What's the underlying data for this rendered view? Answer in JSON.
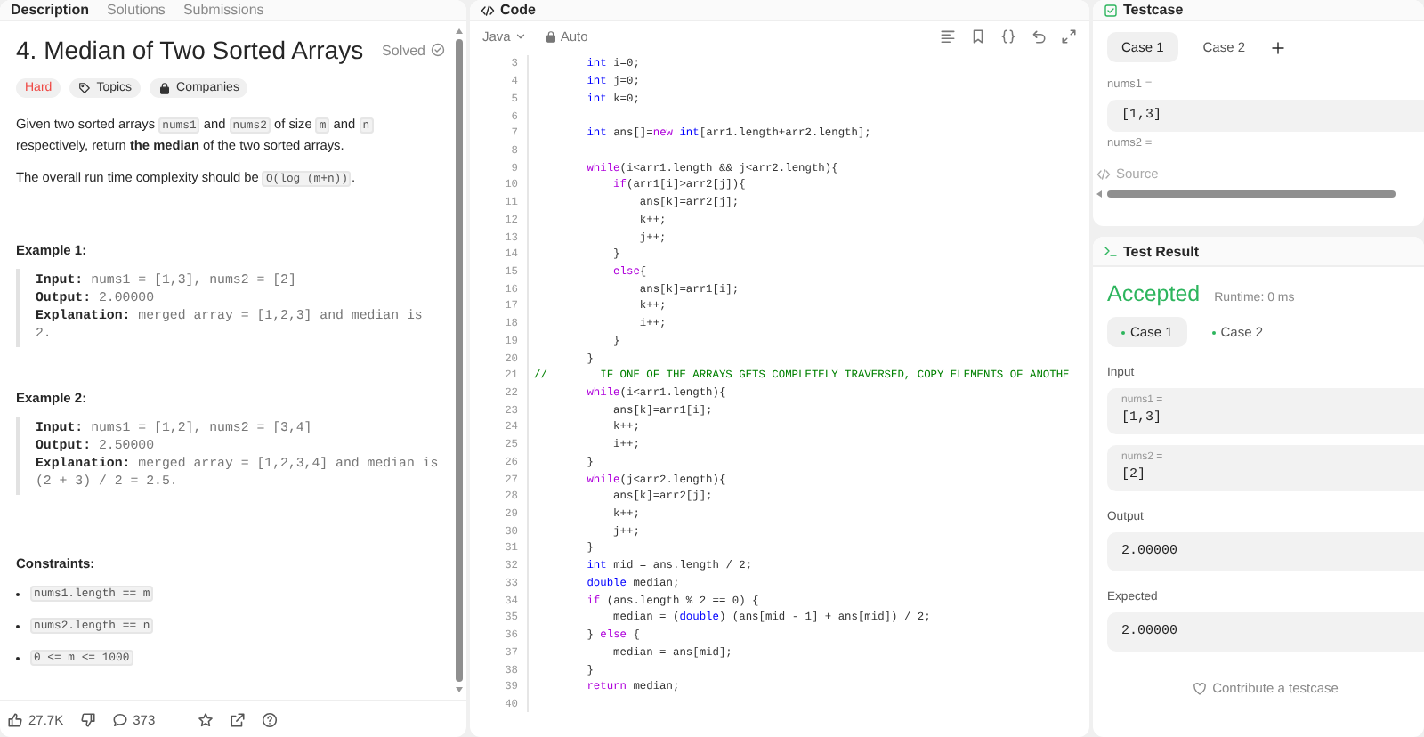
{
  "left_panel": {
    "tabs": [
      {
        "label": "Description",
        "selected": true
      },
      {
        "label": "Solutions",
        "selected": false
      },
      {
        "label": "Submissions",
        "selected": false
      }
    ],
    "title": "4. Median of Two Sorted Arrays",
    "status": "Solved",
    "tags": [
      {
        "label": "Hard",
        "kind": "difficulty"
      },
      {
        "label": "Topics",
        "kind": "topics"
      },
      {
        "label": "Companies",
        "kind": "companies"
      }
    ],
    "paragraphs": [
      [
        {
          "text": "Given two sorted arrays ",
          "kind": "text"
        },
        {
          "text": "nums1",
          "kind": "code"
        },
        {
          "text": " and ",
          "kind": "text"
        },
        {
          "text": "nums2",
          "kind": "code"
        },
        {
          "text": " of size ",
          "kind": "text"
        },
        {
          "text": "m",
          "kind": "code"
        },
        {
          "text": " and ",
          "kind": "text"
        },
        {
          "text": "n",
          "kind": "code"
        },
        {
          "text": " respectively, return ",
          "kind": "text"
        },
        {
          "text": "the median",
          "kind": "bold"
        },
        {
          "text": " of the two sorted arrays.",
          "kind": "text"
        }
      ],
      [
        {
          "text": "The overall run time complexity should be ",
          "kind": "text"
        },
        {
          "text": "O(log (m+n))",
          "kind": "code"
        },
        {
          "text": ".",
          "kind": "text"
        }
      ]
    ],
    "examples": [
      {
        "heading": "Example 1:",
        "lines": [
          {
            "label": "Input:",
            "value": "nums1 = [1,3], nums2 = [2]"
          },
          {
            "label": "Output:",
            "value": "2.00000"
          },
          {
            "label": "Explanation:",
            "value": "merged array = [1,2,3] and median is 2."
          }
        ]
      },
      {
        "heading": "Example 2:",
        "lines": [
          {
            "label": "Input:",
            "value": "nums1 = [1,2], nums2 = [3,4]"
          },
          {
            "label": "Output:",
            "value": "2.50000"
          },
          {
            "label": "Explanation:",
            "value": "merged array = [1,2,3,4] and median is (2 + 3) / 2 = 2.5."
          }
        ]
      }
    ],
    "constraints_heading": "Constraints:",
    "constraints": [
      "nums1.length == m",
      "nums2.length == n",
      "0 <= m <= 1000"
    ],
    "likes": "27.7K",
    "comments": "373"
  },
  "code_panel": {
    "tab": "Code",
    "language": "Java",
    "mode": "Auto",
    "lines": [
      {
        "number": "3",
        "segments": [
          {
            "text": "        int",
            "kind": "type"
          },
          {
            "text": " i=0;",
            "kind": "plain"
          }
        ]
      },
      {
        "number": "4",
        "segments": [
          {
            "text": "        int",
            "kind": "type"
          },
          {
            "text": " j=0;",
            "kind": "plain"
          }
        ]
      },
      {
        "number": "5",
        "segments": [
          {
            "text": "        int",
            "kind": "type"
          },
          {
            "text": " k=0;",
            "kind": "plain"
          }
        ]
      },
      {
        "number": "6"
      },
      {
        "number": "7",
        "segments": [
          {
            "text": "        int",
            "kind": "type"
          },
          {
            "text": " ans[]=",
            "kind": "plain"
          },
          {
            "text": "new",
            "kind": "keyword"
          },
          {
            "text": " int",
            "kind": "type"
          },
          {
            "text": "[arr1.length+arr2.length];",
            "kind": "plain"
          }
        ]
      },
      {
        "number": "8"
      },
      {
        "number": "9",
        "segments": [
          {
            "text": "        while",
            "kind": "keyword"
          },
          {
            "text": "(i<arr1.length && j<arr2.length){",
            "kind": "plain"
          }
        ]
      },
      {
        "number": "10",
        "segments": [
          {
            "text": "            if",
            "kind": "keyword"
          },
          {
            "text": "(arr1[i]>arr2[j]){",
            "kind": "plain"
          }
        ]
      },
      {
        "number": "11",
        "segments": [
          {
            "text": "                ans[k]=arr2[j];",
            "kind": "plain"
          }
        ]
      },
      {
        "number": "12",
        "segments": [
          {
            "text": "                k++;",
            "kind": "plain"
          }
        ]
      },
      {
        "number": "13",
        "segments": [
          {
            "text": "                j++;",
            "kind": "plain"
          }
        ]
      },
      {
        "number": "14",
        "segments": [
          {
            "text": "            }",
            "kind": "plain"
          }
        ]
      },
      {
        "number": "15",
        "segments": [
          {
            "text": "            else",
            "kind": "keyword"
          },
          {
            "text": "{",
            "kind": "plain"
          }
        ]
      },
      {
        "number": "16",
        "segments": [
          {
            "text": "                ans[k]=arr1[i];",
            "kind": "plain"
          }
        ]
      },
      {
        "number": "17",
        "segments": [
          {
            "text": "                k++;",
            "kind": "plain"
          }
        ]
      },
      {
        "number": "18",
        "segments": [
          {
            "text": "                i++;",
            "kind": "plain"
          }
        ]
      },
      {
        "number": "19",
        "segments": [
          {
            "text": "            }",
            "kind": "plain"
          }
        ]
      },
      {
        "number": "20",
        "segments": [
          {
            "text": "        }",
            "kind": "plain"
          }
        ]
      },
      {
        "number": "21",
        "segments": [
          {
            "text": "//        IF ONE OF THE ARRAYS GETS COMPLETELY TRAVERSED, COPY ELEMENTS OF ANOTHE",
            "kind": "comment"
          }
        ]
      },
      {
        "number": "22",
        "segments": [
          {
            "text": "        while",
            "kind": "keyword"
          },
          {
            "text": "(i<arr1.length){",
            "kind": "plain"
          }
        ]
      },
      {
        "number": "23",
        "segments": [
          {
            "text": "            ans[k]=arr1[i];",
            "kind": "plain"
          }
        ]
      },
      {
        "number": "24",
        "segments": [
          {
            "text": "            k++;",
            "kind": "plain"
          }
        ]
      },
      {
        "number": "25",
        "segments": [
          {
            "text": "            i++;",
            "kind": "plain"
          }
        ]
      },
      {
        "number": "26",
        "segments": [
          {
            "text": "        }",
            "kind": "plain"
          }
        ]
      },
      {
        "number": "27",
        "segments": [
          {
            "text": "        while",
            "kind": "keyword"
          },
          {
            "text": "(j<arr2.length){",
            "kind": "plain"
          }
        ]
      },
      {
        "number": "28",
        "segments": [
          {
            "text": "            ans[k]=arr2[j];",
            "kind": "plain"
          }
        ]
      },
      {
        "number": "29",
        "segments": [
          {
            "text": "            k++;",
            "kind": "plain"
          }
        ]
      },
      {
        "number": "30",
        "segments": [
          {
            "text": "            j++;",
            "kind": "plain"
          }
        ]
      },
      {
        "number": "31",
        "segments": [
          {
            "text": "        }",
            "kind": "plain"
          }
        ]
      },
      {
        "number": "32",
        "segments": [
          {
            "text": "        int",
            "kind": "type"
          },
          {
            "text": " mid = ans.length / 2;",
            "kind": "plain"
          }
        ]
      },
      {
        "number": "33",
        "segments": [
          {
            "text": "        double",
            "kind": "type"
          },
          {
            "text": " median;",
            "kind": "plain"
          }
        ]
      },
      {
        "number": "34",
        "segments": [
          {
            "text": "        if",
            "kind": "keyword"
          },
          {
            "text": " (ans.length % 2 == 0) {",
            "kind": "plain"
          }
        ]
      },
      {
        "number": "35",
        "segments": [
          {
            "text": "            median = (",
            "kind": "plain"
          },
          {
            "text": "double",
            "kind": "type"
          },
          {
            "text": ") (ans[mid - 1] + ans[mid]) / 2;",
            "kind": "plain"
          }
        ]
      },
      {
        "number": "36",
        "segments": [
          {
            "text": "        } ",
            "kind": "plain"
          },
          {
            "text": "else",
            "kind": "keyword"
          },
          {
            "text": " {",
            "kind": "plain"
          }
        ]
      },
      {
        "number": "37",
        "segments": [
          {
            "text": "            median = ans[mid];",
            "kind": "plain"
          }
        ]
      },
      {
        "number": "38",
        "segments": [
          {
            "text": "        }",
            "kind": "plain"
          }
        ]
      },
      {
        "number": "39",
        "segments": [
          {
            "text": "        return",
            "kind": "keyword"
          },
          {
            "text": " median;",
            "kind": "plain"
          }
        ]
      },
      {
        "number": "40"
      }
    ]
  },
  "testcase_panel": {
    "tab": "Testcase",
    "cases": [
      {
        "label": "Case 1",
        "selected": true
      },
      {
        "label": "Case 2",
        "selected": false
      }
    ],
    "params": [
      {
        "name": "nums1 =",
        "value": "[1,3]"
      },
      {
        "name": "nums2 ="
      }
    ],
    "source": "Source"
  },
  "result_panel": {
    "tab": "Test Result",
    "verdict": "Accepted",
    "runtime": "Runtime: 0 ms",
    "cases": [
      {
        "label": "Case 1",
        "selected": true
      },
      {
        "label": "Case 2",
        "selected": false
      }
    ],
    "input_label": "Input",
    "inputs": [
      {
        "name": "nums1 =",
        "value": "[1,3]"
      },
      {
        "name": "nums2 =",
        "value": "[2]"
      }
    ],
    "output_label": "Output",
    "output": "2.00000",
    "expected_label": "Expected",
    "expected": "2.00000",
    "contribute": "Contribute a testcase"
  }
}
